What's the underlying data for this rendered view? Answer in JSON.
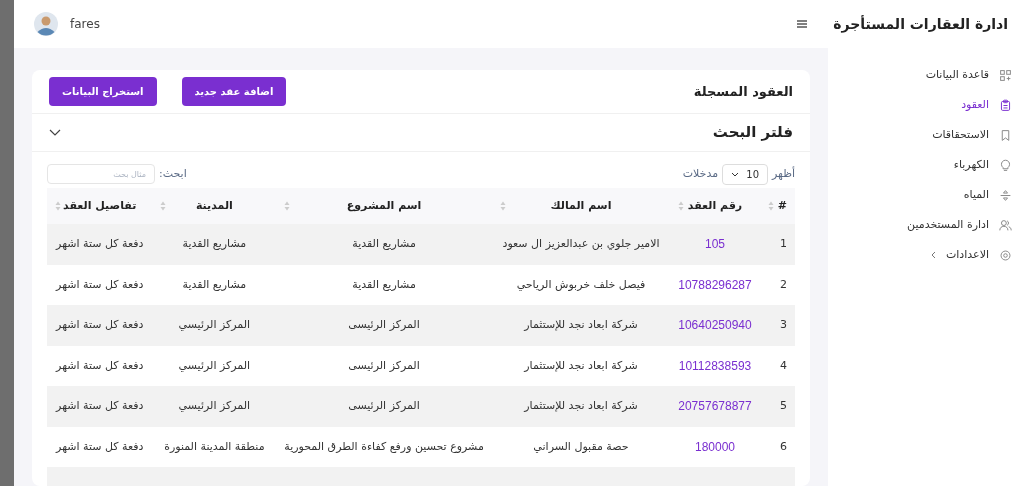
{
  "app_title": "ادارة العقارات المستأجرة",
  "user": {
    "name": "fares"
  },
  "sidebar": {
    "items": [
      {
        "label": "قاعدة البيانات",
        "selected": false,
        "expandable": false
      },
      {
        "label": "العقود",
        "selected": true,
        "expandable": false
      },
      {
        "label": "الاستحقاقات",
        "selected": false,
        "expandable": false
      },
      {
        "label": "الكهرباء",
        "selected": false,
        "expandable": false
      },
      {
        "label": "المياه",
        "selected": false,
        "expandable": false
      },
      {
        "label": "ادارة المستخدمين",
        "selected": false,
        "expandable": false
      },
      {
        "label": "الاعدادات",
        "selected": false,
        "expandable": true
      }
    ]
  },
  "card": {
    "title": "العقود المسجلة",
    "buttons": [
      "اضافة عقد جديد",
      "استخراج البيانات"
    ]
  },
  "filter": {
    "title": "فلتر البحث",
    "expanded": false
  },
  "table_controls": {
    "show_label": "أظهر",
    "page_size": "10",
    "entries_label": "مدخلات",
    "search_label": "ابحث:",
    "search_placeholder": "مثال بحث"
  },
  "table": {
    "columns": [
      "#",
      "رقم العقد",
      "اسم المالك",
      "اسم المشروع",
      "المدينة",
      "تفاصيل العقد"
    ],
    "rows": [
      [
        "1",
        "105",
        "الامير جلوي بن عبدالعزيز ال سعود",
        "مشاريع القدية",
        "مشاريع القدية",
        "دفعة كل ستة اشهر"
      ],
      [
        "2",
        "10788296287",
        "فيصل خلف خربوش الرياحي",
        "مشاريع القدية",
        "مشاريع القدية",
        "دفعة كل ستة اشهر"
      ],
      [
        "3",
        "10640250940",
        "شركة ابعاد نجد للإستثمار",
        "المركز الرئيسى",
        "المركز الرئيسي",
        "دفعة كل ستة اشهر"
      ],
      [
        "4",
        "10112838593",
        "شركة ابعاد نجد للإستثمار",
        "المركز الرئيسى",
        "المركز الرئيسي",
        "دفعة كل ستة اشهر"
      ],
      [
        "5",
        "20757678877",
        "شركة ابعاد نجد للإستثمار",
        "المركز الرئيسى",
        "المركز الرئيسي",
        "دفعة كل ستة اشهر"
      ],
      [
        "6",
        "180000",
        "حصة مقبول السراني",
        "مشروع تحسين ورفع كفاءة الطرق المحورية",
        "منطقة المدينة المنورة",
        "دفعة كل ستة اشهر"
      ]
    ]
  }
}
